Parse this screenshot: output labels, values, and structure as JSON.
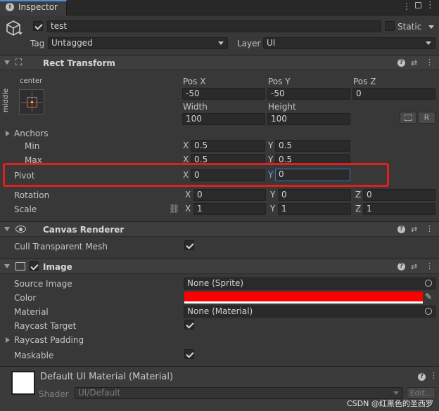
{
  "tab": {
    "title": "Inspector"
  },
  "object": {
    "name": "test",
    "static_label": "Static",
    "tag_label": "Tag",
    "tag_value": "Untagged",
    "layer_label": "Layer",
    "layer_value": "UI"
  },
  "rect": {
    "title": "Rect Transform",
    "anchor_h": "center",
    "anchor_v": "middle",
    "col_labels": [
      "Pos X",
      "Pos Y",
      "Pos Z"
    ],
    "pos_x": "-50",
    "pos_y": "-50",
    "pos_z": "0",
    "width_label": "Width",
    "height_label": "Height",
    "width": "100",
    "height": "100",
    "r_label": "R",
    "anchors_label": "Anchors",
    "min_label": "Min",
    "max_label": "Max",
    "min_x": "0.5",
    "min_y": "0.5",
    "max_x": "0.5",
    "max_y": "0.5",
    "pivot_label": "Pivot",
    "pivot_x": "0",
    "pivot_y": "0",
    "rotation_label": "Rotation",
    "rot_x": "0",
    "rot_y": "0",
    "rot_z": "0",
    "scale_label": "Scale",
    "scale_x": "1",
    "scale_y": "1",
    "scale_z": "1",
    "x": "X",
    "y": "Y",
    "z": "Z"
  },
  "canvas_renderer": {
    "title": "Canvas Renderer",
    "cull_label": "Cull Transparent Mesh"
  },
  "image": {
    "title": "Image",
    "source_label": "Source Image",
    "source_value": "None (Sprite)",
    "color_label": "Color",
    "color_value": "#ff0000",
    "material_label": "Material",
    "material_value": "None (Material)",
    "raycast_label": "Raycast Target",
    "padding_label": "Raycast Padding",
    "maskable_label": "Maskable"
  },
  "material": {
    "title": "Default UI Material (Material)",
    "shader_label": "Shader",
    "shader_value": "UI/Default",
    "edit_label": "Edit..."
  },
  "watermark": "CSDN @红黑色的圣西罗",
  "colors": {
    "highlight": "#e0201c",
    "accent": "#4a90d9"
  }
}
